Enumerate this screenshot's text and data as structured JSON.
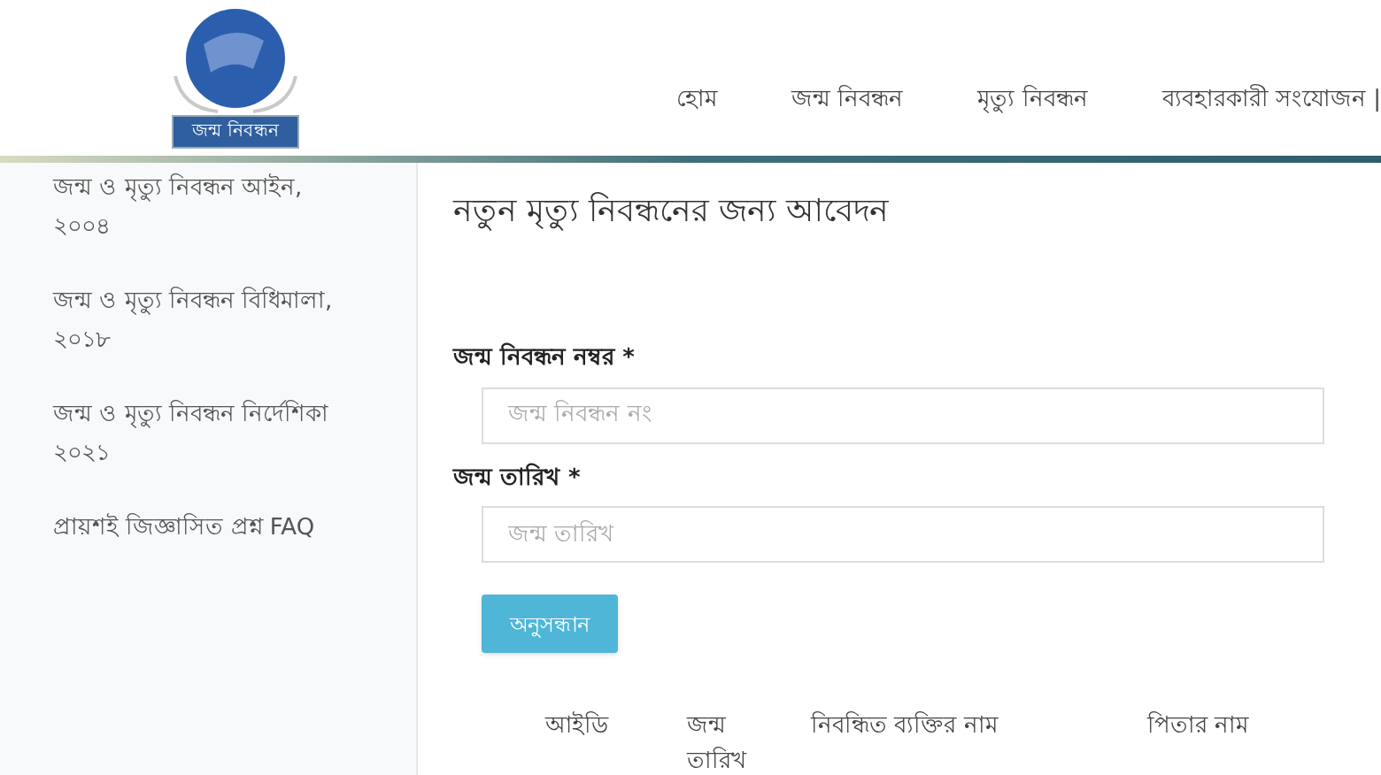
{
  "logo": {
    "caption": "জন্ম নিবন্ধন"
  },
  "nav": [
    "হোম",
    "জন্ম নিবন্ধন",
    "মৃত্যু নিবন্ধন",
    "ব্যবহারকারী সংযোজন |"
  ],
  "sidebar": {
    "items": [
      "জন্ম ও মৃত্যু নিবন্ধন আইন, ২০০৪",
      "জন্ম ও মৃত্যু নিবন্ধন বিধিমালা, ২০১৮",
      "জন্ম ও মৃত্যু নিবন্ধন নির্দেশিকা ২০২১",
      "প্রায়শই জিজ্ঞাসিত প্রশ্ন FAQ"
    ]
  },
  "form": {
    "title": "নতুন মৃত্যু নিবন্ধনের জন্য আবেদন",
    "fields": [
      {
        "label": "জন্ম নিবন্ধন নম্বর *",
        "placeholder": "জন্ম নিবন্ধন নং"
      },
      {
        "label": "জন্ম তারিখ *",
        "placeholder": "জন্ম তারিখ"
      }
    ],
    "button": "অনুসন্ধান"
  },
  "table": {
    "columns": [
      "আইডি",
      "জন্ম তারিখ",
      "নিবন্ধিত ব্যক্তির নাম",
      "পিতার নাম"
    ]
  }
}
